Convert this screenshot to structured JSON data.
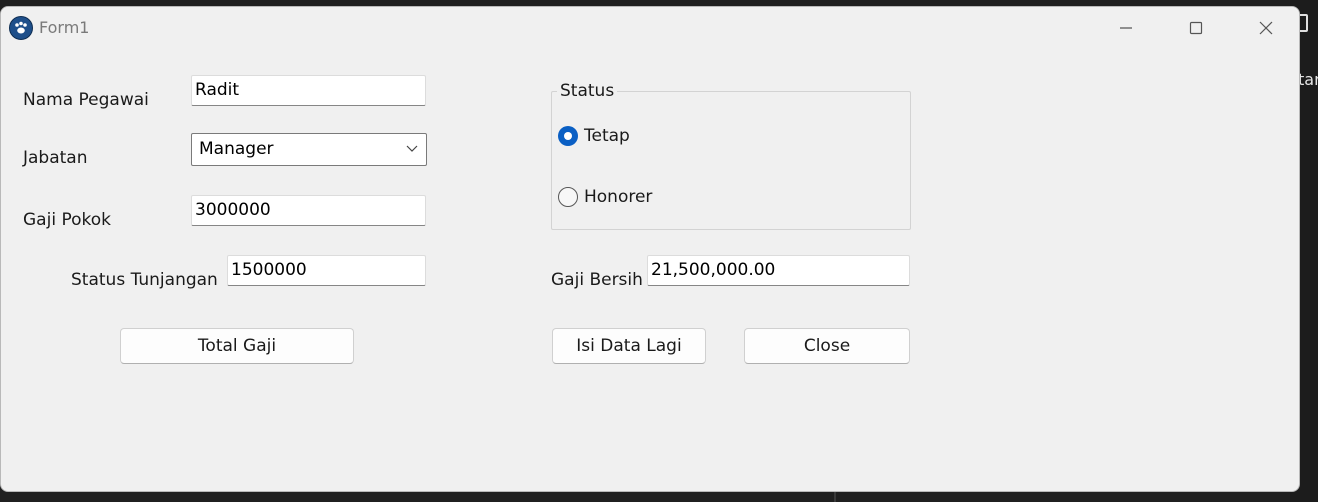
{
  "window": {
    "title": "Form1"
  },
  "background_app": {
    "partial_text": "tar"
  },
  "form": {
    "nama_pegawai": {
      "label": "Nama Pegawai",
      "value": "Radit"
    },
    "jabatan": {
      "label": "Jabatan",
      "selected": "Manager"
    },
    "gaji_pokok": {
      "label": "Gaji Pokok",
      "value": "3000000"
    },
    "status_tunjangan": {
      "label": "Status Tunjangan",
      "value": "1500000"
    },
    "status": {
      "title": "Status",
      "options": [
        {
          "label": "Tetap",
          "selected": true
        },
        {
          "label": "Honorer",
          "selected": false
        }
      ]
    },
    "gaji_bersih": {
      "label": "Gaji Bersih",
      "value": "21,500,000.00"
    }
  },
  "buttons": {
    "total_gaji": "Total Gaji",
    "isi_data_lagi": "Isi Data Lagi",
    "close": "Close"
  },
  "colors": {
    "accent": "#0a5fc4",
    "window_bg": "#f0f0f0"
  }
}
